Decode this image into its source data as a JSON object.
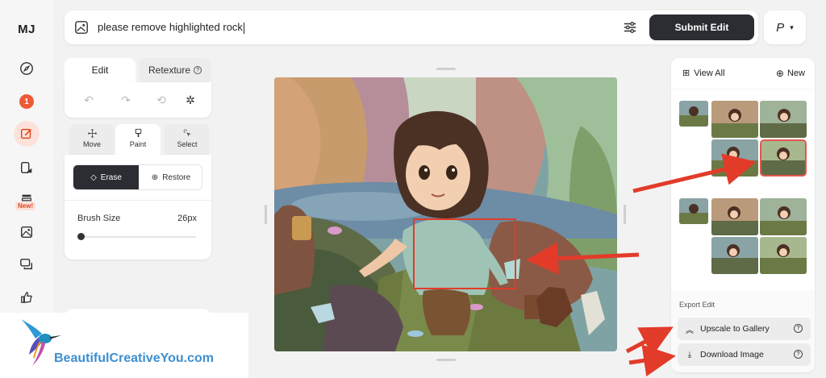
{
  "app": {
    "logo": "MJ",
    "notification_count": "1",
    "new_badge": "New!"
  },
  "rail": {
    "icons": [
      "compass-icon",
      "notification-badge",
      "edit-icon",
      "gallery-icon",
      "new-feature-icon",
      "image-icon",
      "chat-icon",
      "thumbs-up-icon"
    ]
  },
  "prompt": {
    "text": "please remove highlighted rock",
    "submit_label": "Submit Edit",
    "profile_initial": "P"
  },
  "editor": {
    "tabs": [
      {
        "label": "Edit",
        "active": true
      },
      {
        "label": "Retexture",
        "active": false
      }
    ],
    "modes": [
      {
        "label": "Move",
        "active": false
      },
      {
        "label": "Paint",
        "active": true
      },
      {
        "label": "Select",
        "active": false
      }
    ],
    "erase_label": "Erase",
    "restore_label": "Restore",
    "brush_size_label": "Brush Size",
    "brush_size_value": "26px",
    "brush_level": 0.05
  },
  "gallery": {
    "view_all_label": "View All",
    "new_label": "New",
    "export_label": "Export Edit",
    "upscale_label": "Upscale to Gallery",
    "download_label": "Download Image"
  },
  "watermark": {
    "text": "BeautifulCreativeYou.com"
  },
  "colors": {
    "accent": "#ee5a36",
    "dark_button": "#2b2d33",
    "annotation_red": "#e23b2a",
    "watermark_blue": "#3d8fd1"
  }
}
